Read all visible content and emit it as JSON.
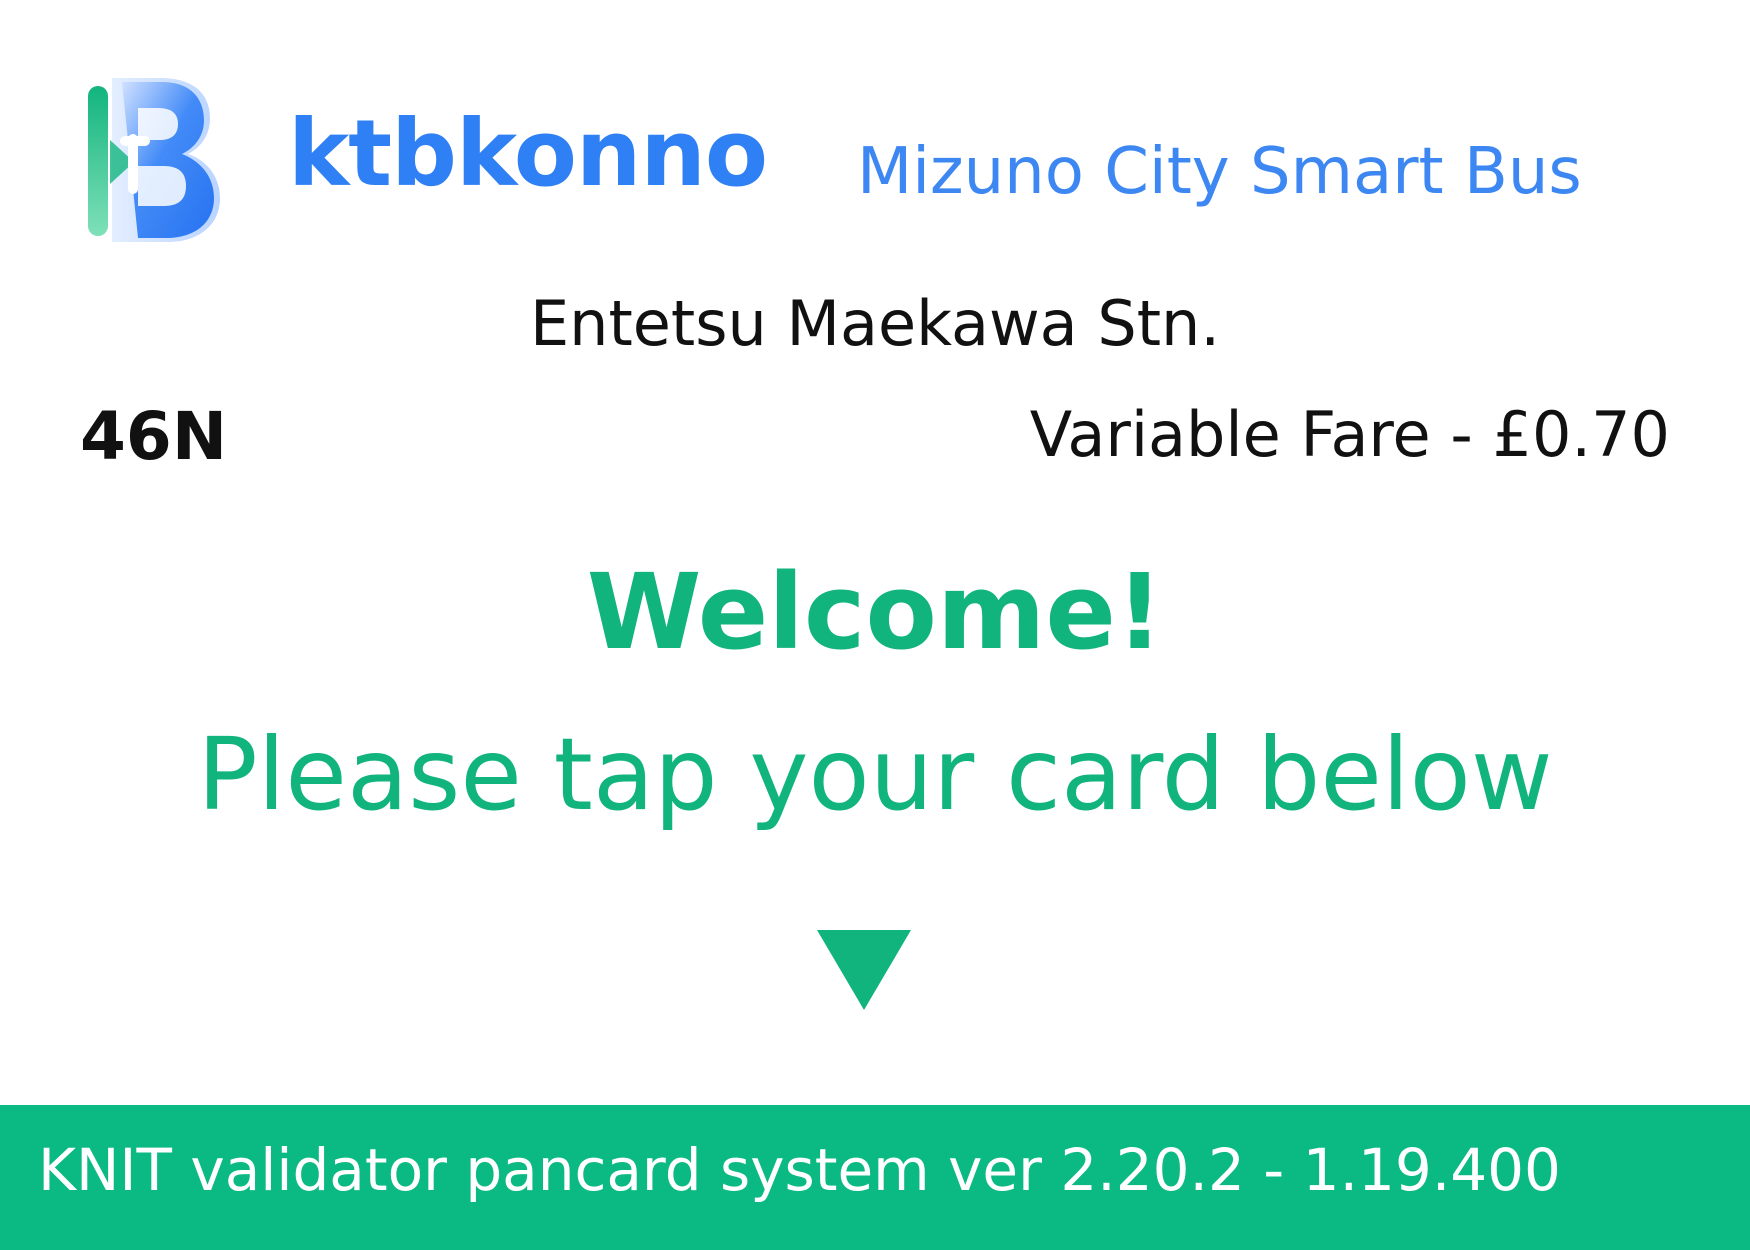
{
  "header": {
    "brand_name": "ktbkonno",
    "service_name": "Mizuno City Smart Bus",
    "logo_icon": "ktbkonno-logo-icon",
    "brand_color": "#2f80f5"
  },
  "trip": {
    "stop_name": "Entetsu Maekawa Stn.",
    "route_number": "46N",
    "fare_text": "Variable Fare - £0.70"
  },
  "prompt": {
    "welcome": "Welcome!",
    "instruction": "Please tap your card below",
    "arrow_icon": "down-triangle-icon",
    "accent_color": "#12b47e"
  },
  "footer": {
    "system_text": "KNIT validator pancard system ver 2.20.2 - 1.19.400",
    "background_color": "#0bb983"
  }
}
